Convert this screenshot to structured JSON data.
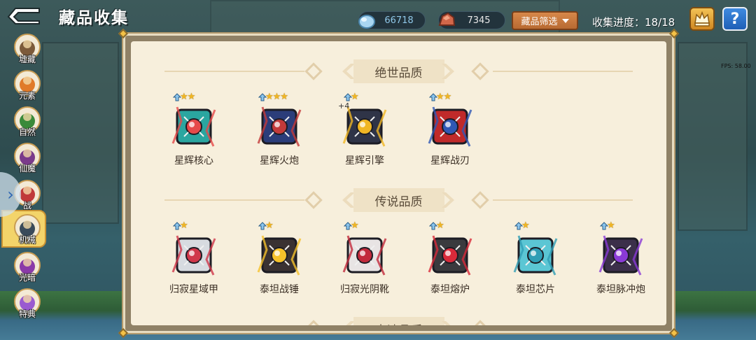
{
  "header": {
    "title": "藏品收集",
    "progress_label": "收集进度：18/18"
  },
  "resources": {
    "stone": {
      "value": "66718",
      "icon": "blue-stone-icon"
    },
    "ore": {
      "value": "7345",
      "icon": "red-ore-icon"
    }
  },
  "filter": {
    "label": "藏品筛选"
  },
  "help_label": "?",
  "fps_text": "FPS: 58.00",
  "sidebar": {
    "items": [
      {
        "label": "墟藏",
        "icon": "bag-icon",
        "color": "#7c5a3a"
      },
      {
        "label": "元素",
        "icon": "flame-icon",
        "color": "#e07a2a"
      },
      {
        "label": "自然",
        "icon": "tree-icon",
        "color": "#3a8a3a"
      },
      {
        "label": "仙魔",
        "icon": "demon-icon",
        "color": "#7a3a8a"
      },
      {
        "label": "战",
        "icon": "battle-icon",
        "color": "#c03a3a"
      },
      {
        "label": "机械",
        "icon": "robot-icon",
        "color": "#3a4a5a"
      },
      {
        "label": "光暗",
        "icon": "light-dark-icon",
        "color": "#8a3aa8"
      },
      {
        "label": "特典",
        "icon": "special-icon",
        "color": "#9a5ad0"
      }
    ],
    "active_index": 5
  },
  "sections": [
    {
      "title": "绝世品质",
      "items": [
        {
          "name": "星辉核心",
          "stars": "★★",
          "bonus": "",
          "color": "#2aa6a0",
          "accent": "#e64a4a"
        },
        {
          "name": "星辉火炮",
          "stars": "★★★",
          "bonus": "",
          "color": "#2b3d7a",
          "accent": "#c33a3a"
        },
        {
          "name": "星辉引擎",
          "stars": "★",
          "bonus": "+4",
          "color": "#2f3447",
          "accent": "#f0b624"
        },
        {
          "name": "星辉战刃",
          "stars": "★★",
          "bonus": "",
          "color": "#c02a2a",
          "accent": "#2f58b5"
        }
      ]
    },
    {
      "title": "传说品质",
      "items": [
        {
          "name": "归寂星域甲",
          "stars": "★",
          "bonus": "",
          "color": "#d7dbe0",
          "accent": "#d0374a"
        },
        {
          "name": "泰坦战锤",
          "stars": "★",
          "bonus": "",
          "color": "#3a3232",
          "accent": "#f5c12a"
        },
        {
          "name": "归寂光阴靴",
          "stars": "★",
          "bonus": "",
          "color": "#e8e4e4",
          "accent": "#c22a3c"
        },
        {
          "name": "泰坦熔炉",
          "stars": "★",
          "bonus": "",
          "color": "#3a3a3e",
          "accent": "#d82a3a"
        },
        {
          "name": "泰坦芯片",
          "stars": "★",
          "bonus": "",
          "color": "#5bc6d4",
          "accent": "#2f9eb5"
        },
        {
          "name": "泰坦脉冲炮",
          "stars": "★",
          "bonus": "",
          "color": "#3b2f4a",
          "accent": "#8a3ad6"
        }
      ]
    },
    {
      "title": "史诗品质",
      "items": []
    }
  ]
}
